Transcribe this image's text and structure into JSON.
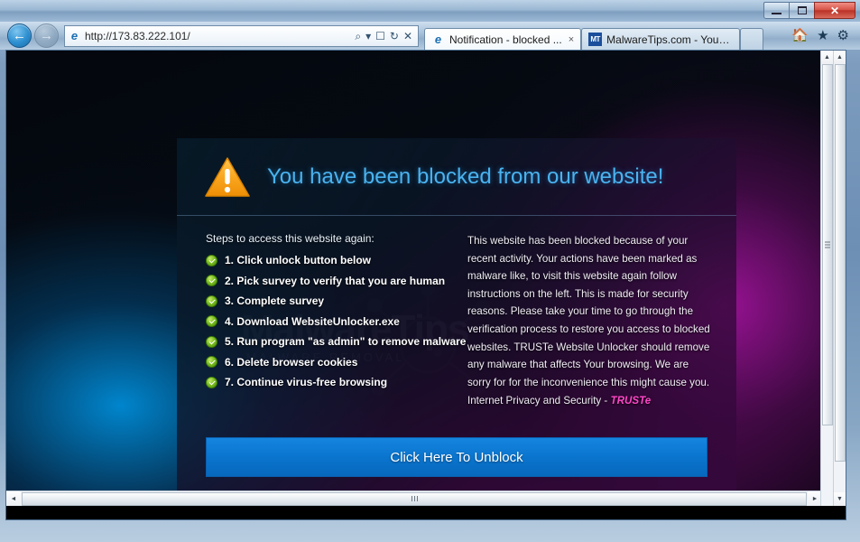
{
  "window": {
    "controls": {
      "minimize": "Minimize",
      "maximize": "Maximize",
      "close": "Close"
    }
  },
  "browser": {
    "back_label": "Back",
    "forward_label": "Forward",
    "url": "http://173.83.222.101/",
    "url_scheme": "http://",
    "url_host": "173.83.222.101/",
    "address_icons": [
      "search-icon",
      "dropdown-arrow-icon",
      "compatibility-view-icon",
      "refresh-icon",
      "stop-icon"
    ],
    "tabs": [
      {
        "title": "Notification - blocked ...",
        "favicon": "internet-explorer-icon",
        "favicon_text": "e",
        "active": true,
        "close": "×"
      },
      {
        "title": "MalwareTips.com - Your P...",
        "favicon": "malwaretips-icon",
        "favicon_text": "MT",
        "active": false
      }
    ],
    "new_tab_label": "",
    "command_icons": [
      "home-icon",
      "favorites-star-icon",
      "tools-gear-icon"
    ]
  },
  "page": {
    "title": "You have been blocked from our website!",
    "warning_icon": "warning-triangle-icon",
    "steps_intro": "Steps to access this website again:",
    "steps": [
      "1. Click unlock button below",
      "2. Pick survey to verify that you are human",
      "3. Complete survey",
      "4. Download WebsiteUnlocker.exe",
      "5. Run program \"as admin\" to remove malware",
      "6. Delete browser cookies",
      "7. Continue virus-free browsing"
    ],
    "description": "This website has been blocked because of your recent activity. Your actions have been marked as malware like, to visit this website again follow instructions on the left. This is made for security reasons. Please take your time to go through the verification process to restore you access to blocked websites. TRUSTe Website Unlocker should remove any malware that affects Your browsing. We are sorry for for the inconvenience this might cause you.",
    "brand_prefix": "Internet Privacy and Security - ",
    "brand_name": "TRUSTe",
    "unblock_button": "Click Here To Unblock",
    "watermark_text": "MalwareTips",
    "watermark_sub": "MALWARE REMOVAL",
    "colors": {
      "title_blue": "#4ab3ef",
      "button_blue": "#0a74cd",
      "check_green": "#7cc020",
      "warning_orange": "#f5a623",
      "truste_pink": "#ff46c8"
    }
  },
  "scrollbars": {
    "up_arrow": "▲",
    "down_arrow": "▼",
    "left_arrow": "◄",
    "right_arrow": "►"
  }
}
